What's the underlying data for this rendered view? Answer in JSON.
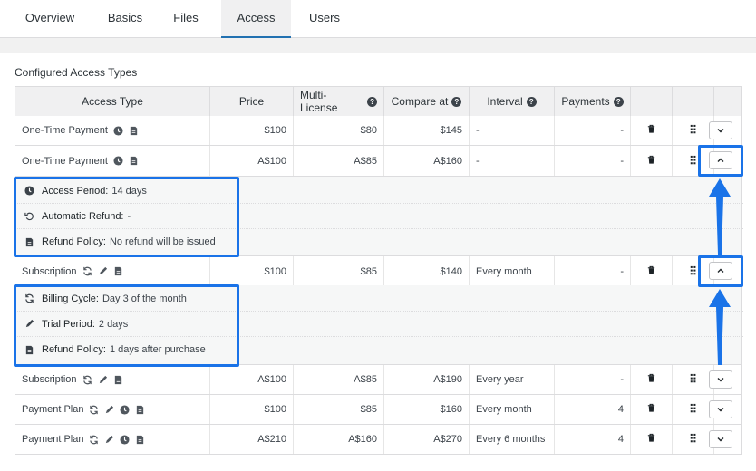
{
  "tabs": [
    "Overview",
    "Basics",
    "Files",
    "Access",
    "Users"
  ],
  "active_tab": "Access",
  "section_title": "Configured Access Types",
  "headers": {
    "access_type": "Access Type",
    "price": "Price",
    "multi_license": "Multi-License",
    "compare_at": "Compare at",
    "interval": "Interval",
    "payments": "Payments"
  },
  "rows": [
    {
      "name": "One-Time Payment",
      "price": "$100",
      "multi": "$80",
      "compare": "$145",
      "interval": "-",
      "payments": "-"
    },
    {
      "name": "One-Time Payment",
      "price": "A$100",
      "multi": "A$85",
      "compare": "A$160",
      "interval": "-",
      "payments": "-"
    },
    {
      "name": "Subscription",
      "price": "$100",
      "multi": "$85",
      "compare": "$140",
      "interval": "Every month",
      "payments": "-"
    },
    {
      "name": "Subscription",
      "price": "A$100",
      "multi": "A$85",
      "compare": "A$190",
      "interval": "Every year",
      "payments": "-"
    },
    {
      "name": "Payment Plan",
      "price": "$100",
      "multi": "$85",
      "compare": "$160",
      "interval": "Every month",
      "payments": "4"
    },
    {
      "name": "Payment Plan",
      "price": "A$210",
      "multi": "A$160",
      "compare": "A$270",
      "interval": "Every 6 months",
      "payments": "4"
    }
  ],
  "detail1": [
    {
      "label": "Access Period:",
      "value": "14 days",
      "icon": "clock-icon"
    },
    {
      "label": "Automatic Refund:",
      "value": "-",
      "icon": "undo-icon"
    },
    {
      "label": "Refund Policy:",
      "value": "No refund will be issued",
      "icon": "document-icon"
    }
  ],
  "detail2": [
    {
      "label": "Billing Cycle:",
      "value": "Day 3 of the month",
      "icon": "refresh-icon"
    },
    {
      "label": "Trial Period:",
      "value": "2 days",
      "icon": "pencil-icon"
    },
    {
      "label": "Refund Policy:",
      "value": "1 days after purchase",
      "icon": "document-icon"
    }
  ],
  "colors": {
    "highlight": "#1a73e8",
    "tab_active_underline": "#2271b1"
  }
}
